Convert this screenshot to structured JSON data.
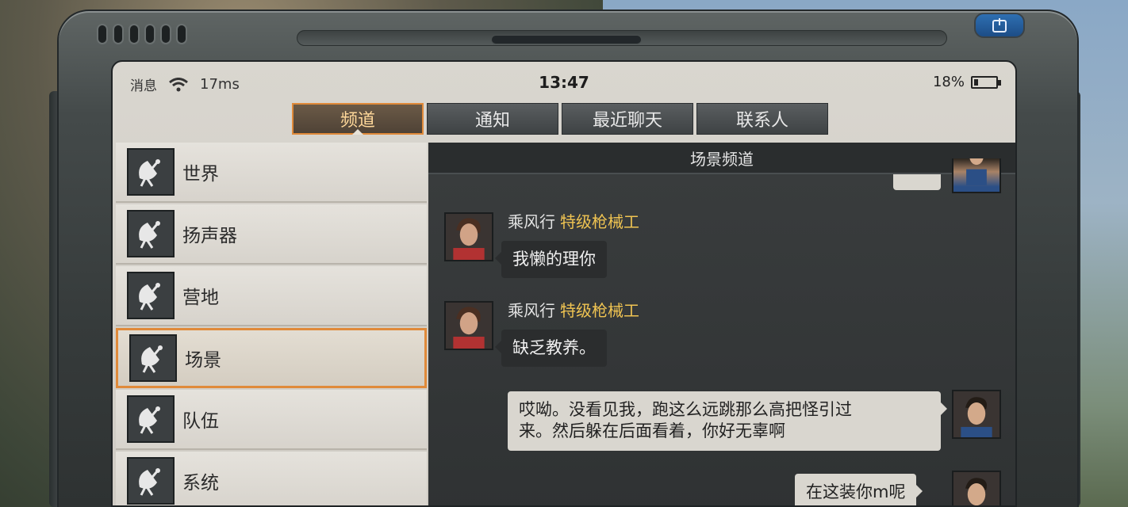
{
  "status_bar": {
    "messages_label": "消息",
    "ping": "17ms",
    "time": "13:47",
    "battery_percent": "18%",
    "battery_level": 0.18
  },
  "tabs": [
    {
      "label": "频道",
      "active": true
    },
    {
      "label": "通知",
      "active": false
    },
    {
      "label": "最近聊天",
      "active": false
    },
    {
      "label": "联系人",
      "active": false
    }
  ],
  "channels": [
    {
      "label": "世界",
      "icon": "satellite-dish-icon",
      "active": false
    },
    {
      "label": "扬声器",
      "icon": "satellite-dish-icon",
      "active": false
    },
    {
      "label": "营地",
      "icon": "satellite-dish-icon",
      "active": false
    },
    {
      "label": "场景",
      "icon": "satellite-dish-icon",
      "active": true
    },
    {
      "label": "队伍",
      "icon": "satellite-dish-icon",
      "active": false
    },
    {
      "label": "系统",
      "icon": "satellite-dish-icon",
      "active": false
    }
  ],
  "chat": {
    "header": "场景频道",
    "messages": [
      {
        "sender": "乘风行",
        "title": "特级枪械工",
        "text": "我懒的理你",
        "self": false
      },
      {
        "sender": "乘风行",
        "title": "特级枪械工",
        "text": "缺乏教养。",
        "self": false
      },
      {
        "text_line1": "哎呦。没看见我，跑这么远跳那么高把怪引过",
        "text_line2": "来。然后躲在后面看着，你好无辜啊",
        "self": true
      },
      {
        "text": "在这装你m呢",
        "self": true
      }
    ]
  },
  "colors": {
    "accent_orange": "#e08a3a",
    "title_gold": "#f0c452"
  }
}
